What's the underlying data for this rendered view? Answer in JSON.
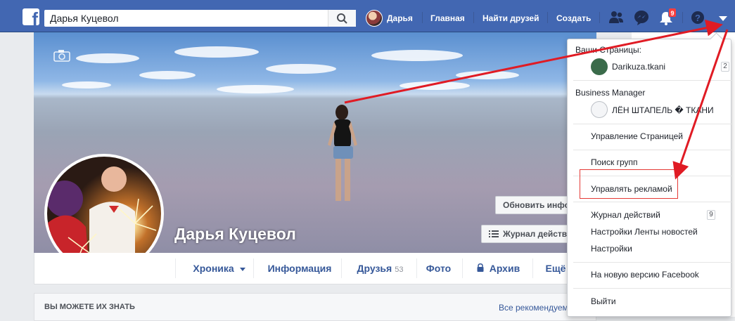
{
  "header": {
    "search_value": "Дарья Куцевол",
    "user_name": "Дарья",
    "nav_home": "Главная",
    "nav_find_friends": "Найти друзей",
    "nav_create": "Создать",
    "notifications_count": "9"
  },
  "profile": {
    "name": "Дарья Куцевол",
    "update_info_button": "Обновить инфо",
    "activity_log_button": "Журнал действ",
    "tabs": [
      {
        "label": "Хроника"
      },
      {
        "label": "Информация"
      },
      {
        "label": "Друзья",
        "count": "53"
      },
      {
        "label": "Фото"
      },
      {
        "label": "Архив"
      },
      {
        "label": "Ещё"
      }
    ],
    "pymk_title": "ВЫ МОЖЕТЕ ИХ ЗНАТЬ",
    "pymk_link": "Все рекомендуем"
  },
  "dropdown": {
    "your_pages_header": "Ваши Страницы:",
    "page_name": "Darikuza.tkani",
    "page_count": "2",
    "business_manager_header": "Business Manager",
    "business_page_name": "ЛЁН ШТАПЕЛЬ � ТКАНИ",
    "manage_pages": "Управление Страницей",
    "find_groups": "Поиск групп",
    "manage_ads": "Управлять рекламой",
    "activity_log": "Журнал действий",
    "activity_log_count": "9",
    "news_feed_settings": "Настройки Ленты новостей",
    "settings": "Настройки",
    "new_facebook": "На новую версию Facebook",
    "logout": "Выйти"
  },
  "colors": {
    "brand_blue": "#4267b2",
    "link_blue": "#365899",
    "annotation_red": "#e53935",
    "badge_red": "#fa3e3e"
  }
}
